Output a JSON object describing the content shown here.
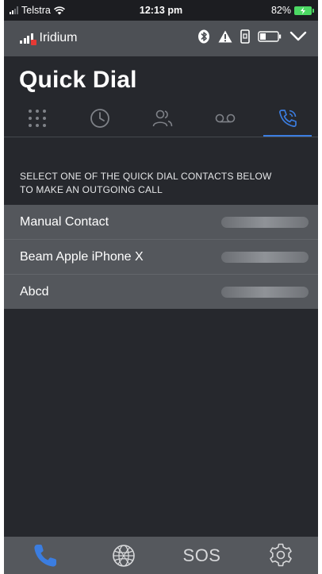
{
  "ios_status": {
    "carrier": "Telstra",
    "time": "12:13 pm",
    "battery_percent": "82%",
    "battery_level": 0.82
  },
  "app_status": {
    "network_name": "Iridium",
    "icons": [
      "bluetooth-icon",
      "warning-icon",
      "sim-icon",
      "battery-icon",
      "chevron-down-icon"
    ]
  },
  "page": {
    "title": "Quick Dial"
  },
  "tabs": [
    {
      "icon": "dialpad-icon",
      "active": false
    },
    {
      "icon": "recents-clock-icon",
      "active": false
    },
    {
      "icon": "contacts-icon",
      "active": false
    },
    {
      "icon": "voicemail-icon",
      "active": false
    },
    {
      "icon": "quick-dial-phone-icon",
      "active": true
    }
  ],
  "instructions": {
    "line1": "SELECT ONE OF THE QUICK DIAL CONTACTS BELOW",
    "line2": "TO MAKE AN OUTGOING CALL"
  },
  "contacts": [
    {
      "name": "Manual Contact",
      "number_blurred": true
    },
    {
      "name": "Beam Apple iPhone X",
      "number_blurred": true
    },
    {
      "name": "Abcd",
      "number_blurred": true
    }
  ],
  "bottom_nav": {
    "items": [
      {
        "icon": "phone-icon",
        "active": true
      },
      {
        "icon": "globe-icon",
        "active": false
      },
      {
        "label": "SOS"
      },
      {
        "icon": "settings-gear-icon",
        "active": false
      }
    ]
  },
  "colors": {
    "accent": "#3b7de0",
    "background": "#26282d",
    "list_row": "#54575c",
    "bar": "#4d5055"
  }
}
